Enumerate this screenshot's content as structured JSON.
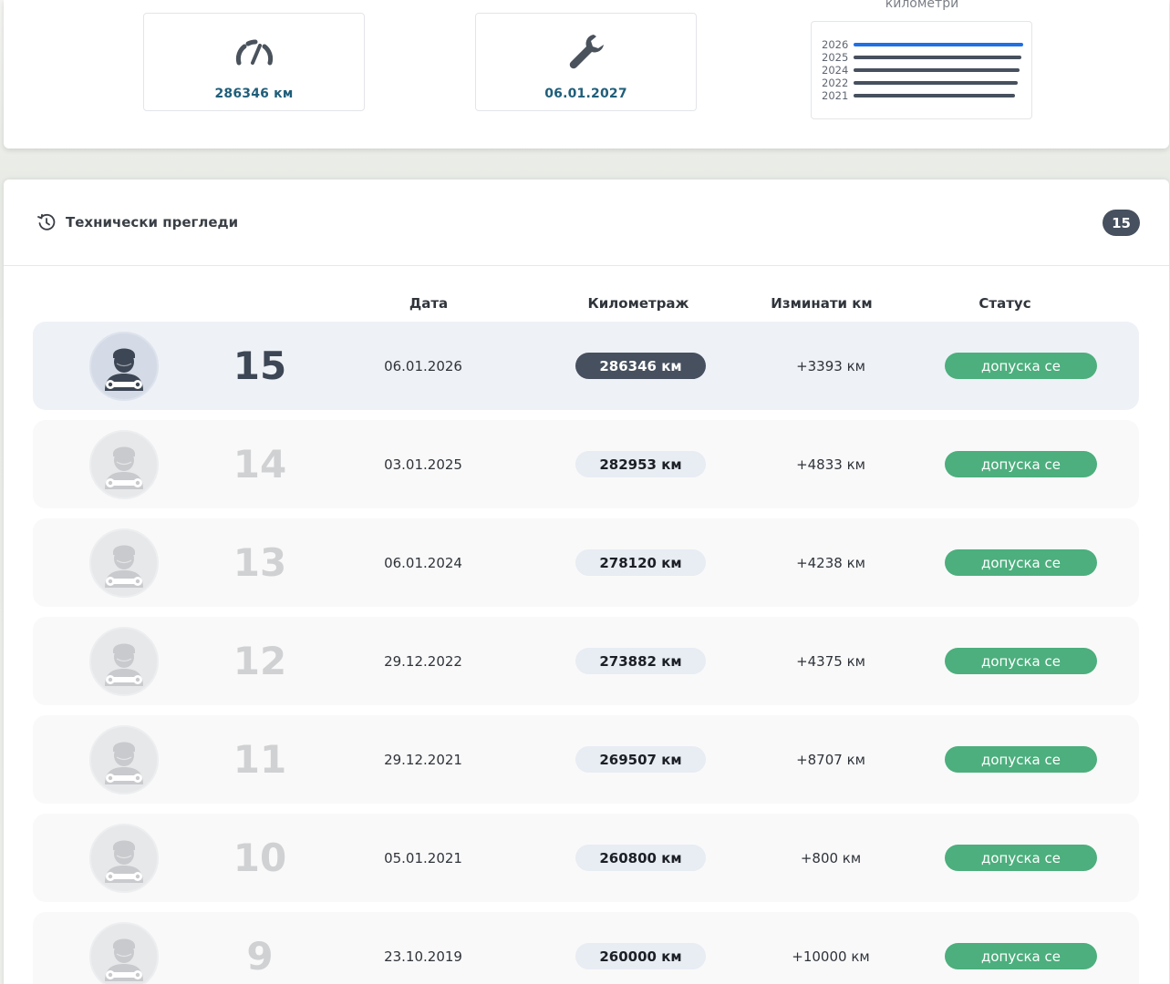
{
  "summary": {
    "mileage": {
      "icon": "speedometer-icon",
      "value": "286346 км"
    },
    "next_inspection": {
      "icon": "wrench-icon",
      "value": "06.01.2027"
    },
    "km_chart": {
      "label": "километри",
      "rows": [
        {
          "year": "2026",
          "value": 286346,
          "current": true
        },
        {
          "year": "2025",
          "value": 282953,
          "current": false
        },
        {
          "year": "2024",
          "value": 278120,
          "current": false
        },
        {
          "year": "2022",
          "value": 273882,
          "current": false
        },
        {
          "year": "2021",
          "value": 269507,
          "current": false
        }
      ]
    }
  },
  "inspections": {
    "title": "Технически прегледи",
    "title_icon": "history-icon",
    "count": "15",
    "columns": {
      "date": "Дата",
      "mileage": "Километраж",
      "diff": "Изминати км",
      "status": "Статус"
    },
    "rows": [
      {
        "num": "15",
        "date": "06.01.2026",
        "km": "286346 км",
        "diff": "+3393 км",
        "status": "допуска се",
        "active": true
      },
      {
        "num": "14",
        "date": "03.01.2025",
        "km": "282953 км",
        "diff": "+4833 км",
        "status": "допуска се",
        "active": false
      },
      {
        "num": "13",
        "date": "06.01.2024",
        "km": "278120 км",
        "diff": "+4238 км",
        "status": "допуска се",
        "active": false
      },
      {
        "num": "12",
        "date": "29.12.2022",
        "km": "273882 км",
        "diff": "+4375 км",
        "status": "допуска се",
        "active": false
      },
      {
        "num": "11",
        "date": "29.12.2021",
        "km": "269507 км",
        "diff": "+8707 км",
        "status": "допуска се",
        "active": false
      },
      {
        "num": "10",
        "date": "05.01.2021",
        "km": "260800 км",
        "diff": "+800 км",
        "status": "допуска се",
        "active": false
      },
      {
        "num": "9",
        "date": "23.10.2019",
        "km": "260000 км",
        "diff": "+10000 км",
        "status": "допуска се",
        "active": false
      }
    ]
  }
}
